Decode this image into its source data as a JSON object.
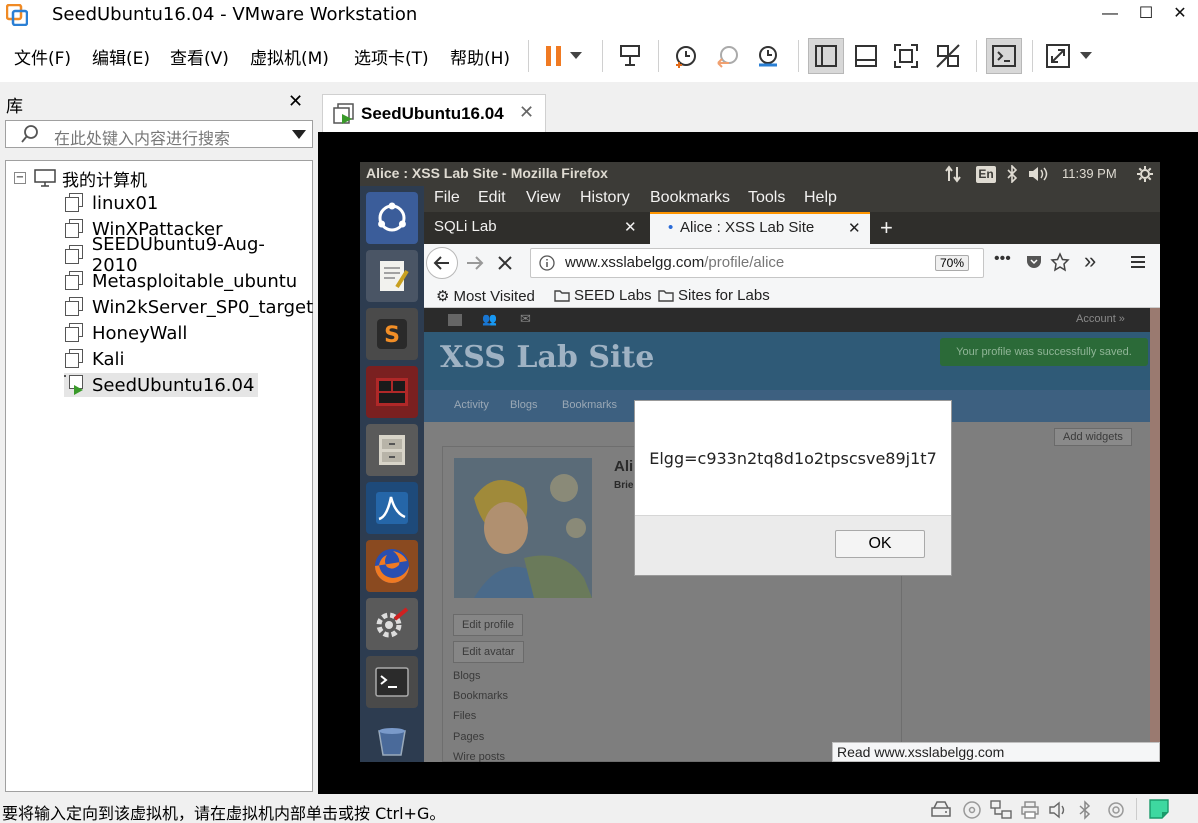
{
  "window": {
    "title": "SeedUbuntu16.04 - VMware Workstation",
    "controls": {
      "minimize": "—",
      "maximize": "☐",
      "close": "✕"
    }
  },
  "menu": {
    "file": "文件(F)",
    "edit": "编辑(E)",
    "view": "查看(V)",
    "vm": "虚拟机(M)",
    "tabs": "选项卡(T)",
    "help": "帮助(H)"
  },
  "library": {
    "title": "库",
    "close": "✕",
    "search_placeholder": "在此处键入内容进行搜索",
    "root": "我的计算机",
    "items": [
      "linux01",
      "WinXPattacker",
      "SEEDUbuntu9-Aug-2010",
      "Metasploitable_ubuntu",
      "Win2kServer_SP0_target",
      "HoneyWall",
      "Kali",
      "SeedUbuntu16.04"
    ],
    "selected_index": 7
  },
  "vm_tab": {
    "label": "SeedUbuntu16.04",
    "close": "✕"
  },
  "guest": {
    "panel": {
      "window_title": "Alice : XSS Lab Site - Mozilla Firefox",
      "keyboard": "En",
      "time": "11:39 PM"
    },
    "firefox": {
      "menu": [
        "File",
        "Edit",
        "View",
        "History",
        "Bookmarks",
        "Tools",
        "Help"
      ],
      "tabs": [
        {
          "label": "SQLi Lab",
          "active": false
        },
        {
          "label": "Alice : XSS Lab Site",
          "active": true
        }
      ],
      "new_tab": "+",
      "url_host": "www.xsslabelgg.com",
      "url_path": "/profile/alice",
      "zoom": "70%",
      "bookmarks": [
        "Most Visited",
        "SEED Labs",
        "Sites for Labs"
      ],
      "status_link": "Read www.xsslabelgg.com"
    },
    "page": {
      "topbar_account": "Account »",
      "site_title": "XSS Lab Site",
      "success_message": "Your profile was successfully saved.",
      "nav": [
        "Activity",
        "Blogs",
        "Bookmarks"
      ],
      "add_widgets": "Add widgets",
      "profile_name_partial": "Ali",
      "profile_brief_partial": "Brie",
      "buttons": [
        "Edit profile",
        "Edit avatar"
      ],
      "links": [
        "Blogs",
        "Bookmarks",
        "Files",
        "Pages",
        "Wire posts"
      ]
    },
    "dialog": {
      "message": "Elgg=c933n2tq8d1o2tpscsve89j1t7",
      "ok_label": "OK"
    }
  },
  "statusbar": {
    "text": "要将输入定向到该虚拟机，请在虚拟机内部单击或按 Ctrl+G。"
  },
  "colors": {
    "pause_orange": "#f07a22",
    "vm_background": "#000000",
    "ubuntu_panel": "#3c3b37",
    "launcher": "#2d3c50",
    "firefox_tab_accent": "#ff9500",
    "elgg_header": "#2f5a77",
    "success_green": "#2b8a3e"
  }
}
